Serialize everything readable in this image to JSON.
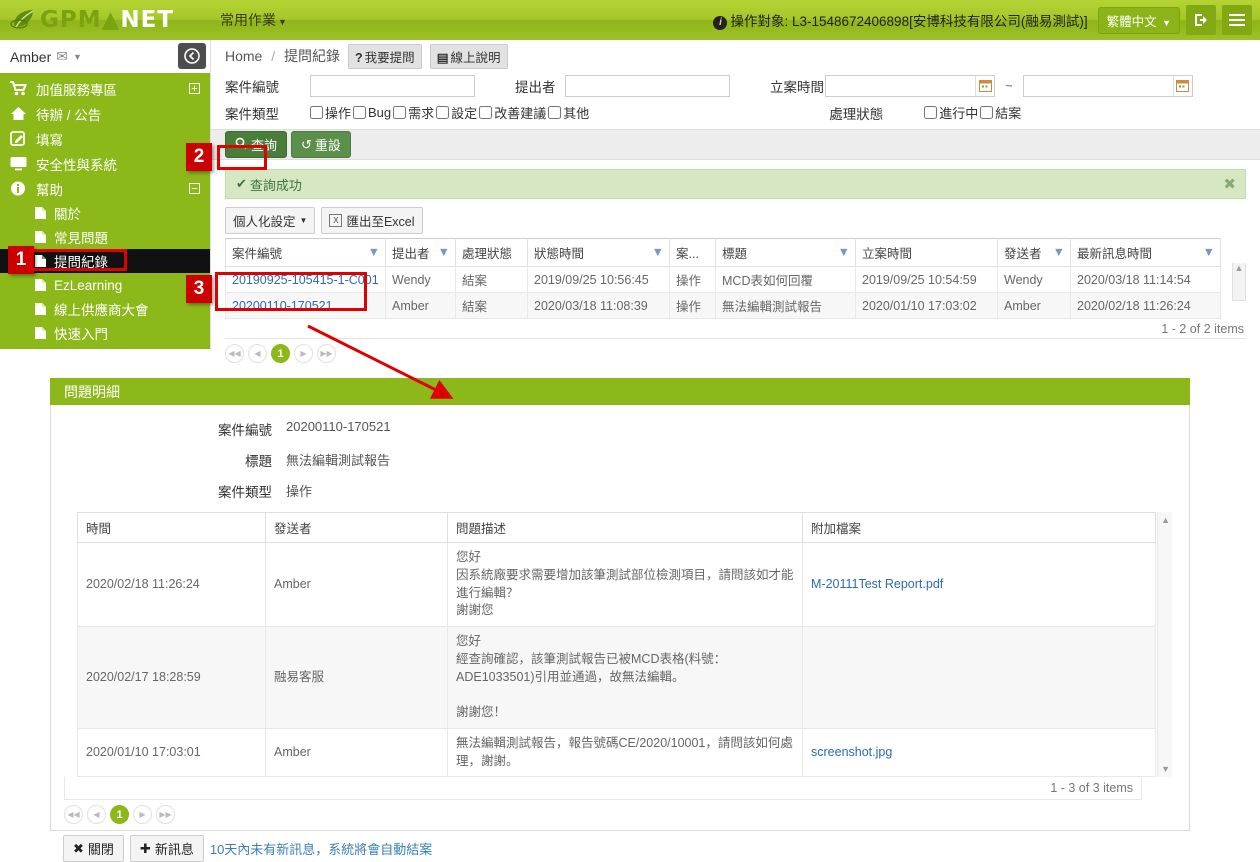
{
  "header": {
    "logo_text_1": "GPM",
    "logo_text_2": "NET",
    "menu_common": "常用作業",
    "op_target": "操作對象: L3-1548672406898[安博科技有限公司(融易測試)]",
    "lang": "繁體中文",
    "logout_icon": "logout-icon",
    "hamburger_icon": "hamburger-icon",
    "info_icon": "info-icon"
  },
  "sidebar": {
    "user": "Amber",
    "collapse_icon": "collapse-left-icon",
    "items": [
      {
        "label": "加值服務專區",
        "icon": "cart-icon",
        "expander": "+"
      },
      {
        "label": "待辦 / 公告",
        "icon": "home-icon",
        "expander": ""
      },
      {
        "label": "填寫",
        "icon": "edit-icon",
        "expander": ""
      },
      {
        "label": "安全性與系統",
        "icon": "monitor-icon",
        "expander": ""
      },
      {
        "label": "幫助",
        "icon": "info-icon",
        "expander": "−"
      }
    ],
    "sub_items": [
      {
        "label": "關於",
        "active": false
      },
      {
        "label": "常見問題",
        "active": false
      },
      {
        "label": "提問紀錄",
        "active": true
      },
      {
        "label": "EzLearning",
        "active": false
      },
      {
        "label": "線上供應商大會",
        "active": false
      },
      {
        "label": "快速入門",
        "active": false
      }
    ]
  },
  "breadcrumb": {
    "home": "Home",
    "sep": "/",
    "current": "提問紀錄",
    "ask_button": "我要提問",
    "ask_icon": "question-mark-icon",
    "help_button": "線上說明",
    "help_icon": "book-icon"
  },
  "search_form": {
    "case_no_label": "案件編號",
    "case_no_value": "",
    "submitter_label": "提出者",
    "submitter_value": "",
    "open_time_label": "立案時間",
    "open_time_from": "",
    "open_time_to": "",
    "tilde": "~",
    "case_type_label": "案件類型",
    "case_types": [
      "操作",
      "Bug",
      "需求",
      "設定",
      "改善建議",
      "其他"
    ],
    "status_label": "處理狀態",
    "statuses": [
      "進行中",
      "結案"
    ],
    "search_button": "查詢",
    "search_icon": "search-icon",
    "reset_button": "重設",
    "reset_icon": "reset-icon"
  },
  "alert": {
    "text": "查詢成功",
    "check_icon": "check-icon",
    "close_icon": "close-icon"
  },
  "grid_tools": {
    "personalize": "個人化設定",
    "export": "匯出至Excel",
    "excel_icon": "excel-icon"
  },
  "result_grid": {
    "columns": [
      {
        "label": "案件編號",
        "filter": true
      },
      {
        "label": "提出者",
        "filter": true
      },
      {
        "label": "處理狀態",
        "filter": false
      },
      {
        "label": "狀態時間",
        "filter": true
      },
      {
        "label": "案...",
        "filter": false
      },
      {
        "label": "標題",
        "filter": true
      },
      {
        "label": "立案時間",
        "filter": false
      },
      {
        "label": "發送者",
        "filter": true
      },
      {
        "label": "最新訊息時間",
        "filter": true
      }
    ],
    "rows": [
      {
        "case_no": "20190925-105415-1-C001",
        "submitter": "Wendy",
        "status": "結案",
        "status_time": "2019/09/25 10:56:45",
        "type": "操作",
        "title": "MCD表如何回覆",
        "open_time": "2019/09/25 10:54:59",
        "sender": "Wendy",
        "last_msg_time": "2020/03/18 11:14:54"
      },
      {
        "case_no": "20200110-170521",
        "submitter": "Amber",
        "status": "結案",
        "status_time": "2020/03/18 11:08:39",
        "type": "操作",
        "title": "無法編輯測試報告",
        "open_time": "2020/01/10 17:03:02",
        "sender": "Amber",
        "last_msg_time": "2020/02/18 11:26:24"
      }
    ],
    "items_count": "1 - 2 of 2 items",
    "page": "1"
  },
  "detail": {
    "title": "問題明細",
    "fields": [
      {
        "label": "案件編號",
        "value": "20200110-170521"
      },
      {
        "label": "標題",
        "value": "無法編輯測試報告"
      },
      {
        "label": "案件類型",
        "value": "操作"
      }
    ],
    "columns": [
      "時間",
      "發送者",
      "問題描述",
      "附加檔案"
    ],
    "rows": [
      {
        "time": "2020/02/18 11:26:24",
        "sender": "Amber",
        "desc": "您好\n因系統廠要求需要增加該筆測試部位檢測項目，請問該如才能進行編輯？\n謝謝您",
        "file": "M-20111Test Report.pdf"
      },
      {
        "time": "2020/02/17 18:28:59",
        "sender": "融易客服",
        "desc": "您好\n經查詢確認，該筆測試報告已被MCD表格(料號：ADE1033501)引用並通過，故無法編輯。\n\n謝謝您！",
        "file": ""
      },
      {
        "time": "2020/01/10 17:03:01",
        "sender": "Amber",
        "desc": "無法編輯測試報告，報告號碼CE/2020/10001，請問該如何處理，謝謝。",
        "file": "screenshot.jpg"
      }
    ],
    "items_count": "1 - 3 of 3 items",
    "page": "1",
    "close_button": "關閉",
    "close_icon": "x-icon",
    "new_msg_button": "新訊息",
    "new_msg_icon": "plus-icon",
    "note": "10天內未有新訊息，系統將會自動結案"
  },
  "annotations": {
    "markers": [
      "1",
      "2",
      "3"
    ],
    "color": "#cc0000"
  }
}
